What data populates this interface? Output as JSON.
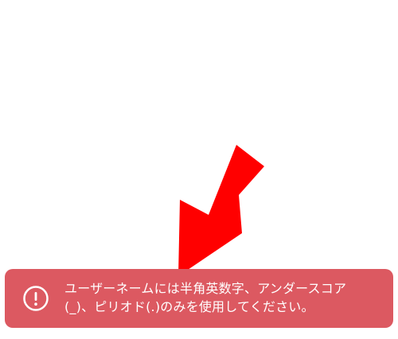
{
  "toast": {
    "type": "error",
    "icon": "exclamation-circle-icon",
    "message_line1": "ユーザーネームには半角英数字、アンダースコア",
    "message_line2": "(_)、ピリオド(.)のみを使用してください。"
  },
  "annotation": {
    "type": "arrow",
    "color": "#ff0000"
  },
  "colors": {
    "background": "#ffffff",
    "toast_background": "#dc5961",
    "toast_text": "#ffffff"
  }
}
